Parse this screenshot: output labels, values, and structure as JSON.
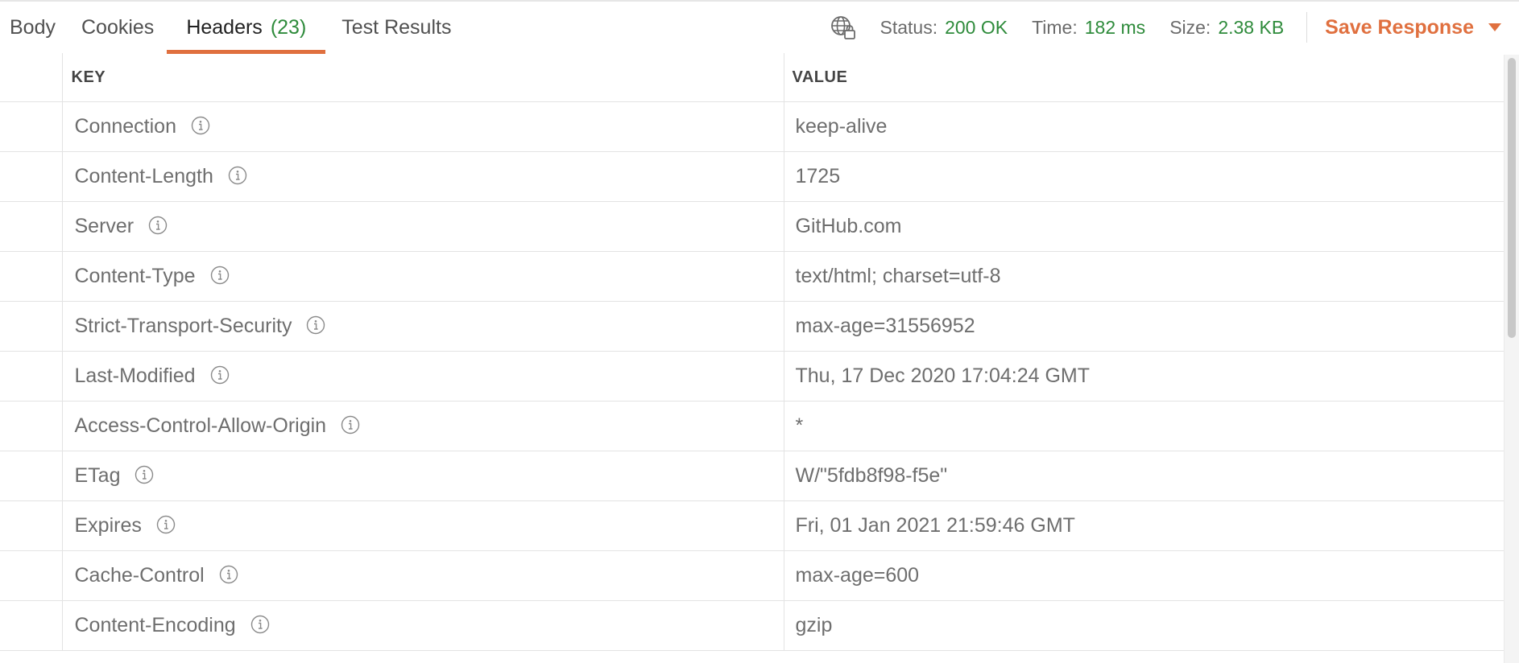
{
  "tabs": [
    {
      "label": "Body",
      "count": ""
    },
    {
      "label": "Cookies",
      "count": ""
    },
    {
      "label": "Headers",
      "count": "(23)"
    },
    {
      "label": "Test Results",
      "count": ""
    }
  ],
  "status": {
    "label": "Status:",
    "value": "200 OK"
  },
  "time": {
    "label": "Time:",
    "value": "182 ms"
  },
  "size": {
    "label": "Size:",
    "value": "2.38 KB"
  },
  "save_label": "Save Response",
  "table": {
    "headers": [
      "KEY",
      "VALUE"
    ],
    "rows": [
      {
        "key": "Connection",
        "value": "keep-alive"
      },
      {
        "key": "Content-Length",
        "value": "1725"
      },
      {
        "key": "Server",
        "value": "GitHub.com"
      },
      {
        "key": "Content-Type",
        "value": "text/html; charset=utf-8"
      },
      {
        "key": "Strict-Transport-Security",
        "value": "max-age=31556952"
      },
      {
        "key": "Last-Modified",
        "value": "Thu, 17 Dec 2020 17:04:24 GMT"
      },
      {
        "key": "Access-Control-Allow-Origin",
        "value": "*"
      },
      {
        "key": "ETag",
        "value": "W/\"5fdb8f98-f5e\""
      },
      {
        "key": "Expires",
        "value": "Fri, 01 Jan 2021 21:59:46 GMT"
      },
      {
        "key": "Cache-Control",
        "value": "max-age=600"
      },
      {
        "key": "Content-Encoding",
        "value": "gzip"
      }
    ]
  },
  "colors": {
    "accent": "#e0703f",
    "success": "#2e8b3b"
  },
  "icons": {
    "globe": "globe-lock-icon",
    "info": "info-icon",
    "caret": "caret-down-icon"
  }
}
